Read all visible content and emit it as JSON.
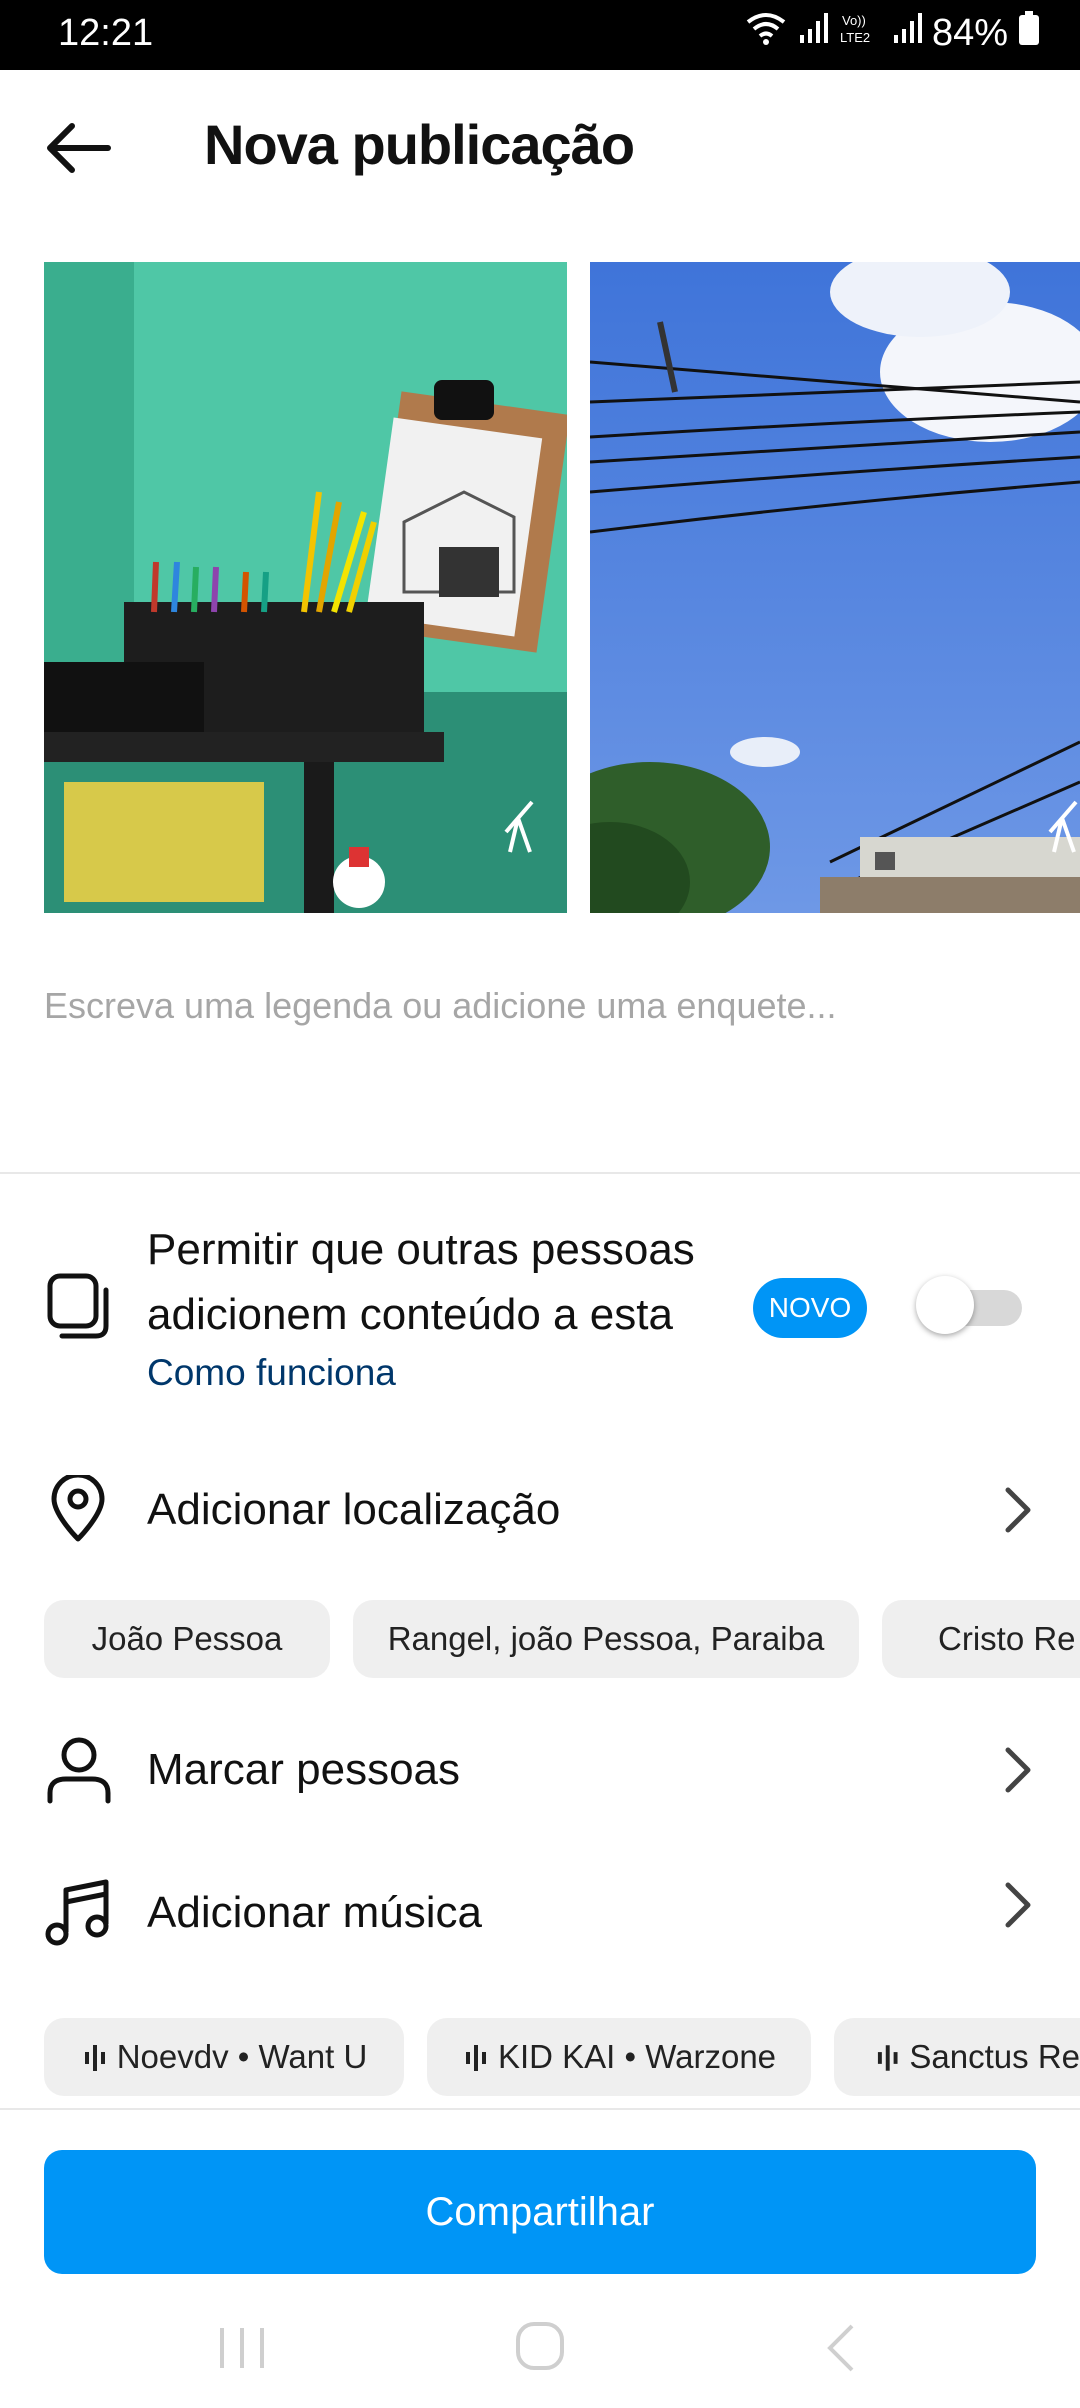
{
  "status_bar": {
    "time": "12:21",
    "battery": "84%",
    "icons": [
      "wifi-icon",
      "signal-icon",
      "volte-icon",
      "signal-icon",
      "battery-icon"
    ]
  },
  "header": {
    "title": "Nova publicação",
    "back_icon": "arrow-left-icon"
  },
  "media": [
    {
      "description_icon": "telescope-icon"
    },
    {
      "description_icon": "telescope-icon"
    }
  ],
  "caption": {
    "placeholder": "Escreva uma legenda ou adicione uma enquete..."
  },
  "collab": {
    "line1": "Permitir que outras pessoas",
    "line2": "adicionem conteúdo a esta",
    "link": "Como funciona",
    "badge": "NOVO",
    "toggle_on": false,
    "icon": "layers-icon"
  },
  "location": {
    "label": "Adicionar localização",
    "icon": "location-pin-icon",
    "suggestions": [
      "João Pessoa",
      "Rangel, joão Pessoa, Paraiba",
      "Cristo Re"
    ]
  },
  "tag_people": {
    "label": "Marcar pessoas",
    "icon": "person-icon"
  },
  "music": {
    "label": "Adicionar música",
    "icon": "music-note-icon",
    "suggestions": [
      "Noevdv • Want U",
      "KID KAI • Warzone",
      "Sanctus Re"
    ]
  },
  "share_button": {
    "label": "Compartilhar"
  },
  "nav_bar": [
    "recents-icon",
    "home-icon",
    "back-icon"
  ],
  "colors": {
    "accent": "#0095f6",
    "chip_bg": "#efefef",
    "link": "#00376b"
  }
}
